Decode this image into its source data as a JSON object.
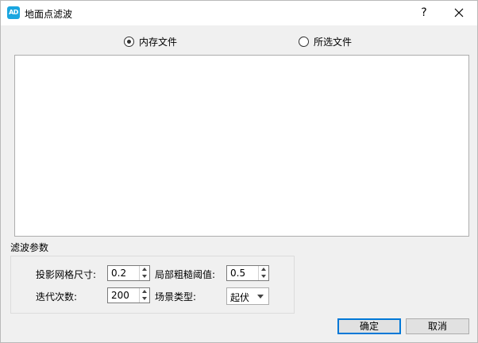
{
  "window": {
    "title": "地面点滤波",
    "app_icon_text": "AD",
    "help_label": "?",
    "icons": {
      "help": "question-mark-icon",
      "close": "close-icon",
      "app": "app-logo-icon"
    }
  },
  "source": {
    "options": [
      {
        "label": "内存文件",
        "selected": true
      },
      {
        "label": "所选文件",
        "selected": false
      }
    ]
  },
  "file_list": {
    "items": []
  },
  "filter_params": {
    "group_title": "滤波参数",
    "grid_size": {
      "label": "投影网格尺寸:",
      "value": "0.2"
    },
    "roughness_threshold": {
      "label": "局部粗糙阈值:",
      "value": "0.5"
    },
    "iterations": {
      "label": "迭代次数:",
      "value": "200"
    },
    "scene_type": {
      "label": "场景类型:",
      "value": "起伏"
    }
  },
  "buttons": {
    "ok": "确定",
    "cancel": "取消"
  },
  "colors": {
    "accent": "#0078d7",
    "icon_bg": "#1aa6e0"
  }
}
